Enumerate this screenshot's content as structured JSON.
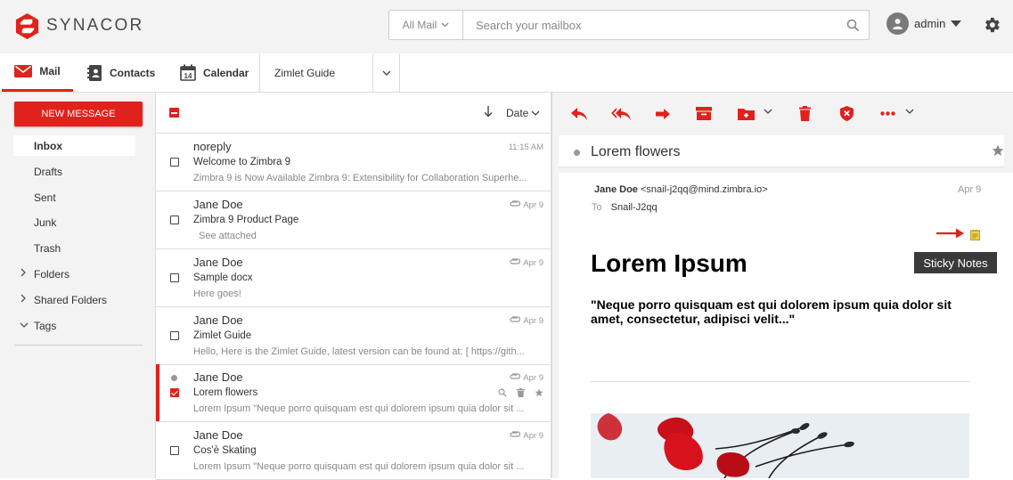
{
  "header": {
    "brand": "SYNACOR",
    "search_scope": "All Mail",
    "search_placeholder": "Search your mailbox",
    "username": "admin"
  },
  "nav": {
    "tabs": [
      {
        "label": "Mail",
        "icon": "mail-icon",
        "active": true
      },
      {
        "label": "Contacts",
        "icon": "contacts-icon"
      },
      {
        "label": "Calendar",
        "icon": "calendar-icon",
        "day": "14"
      }
    ],
    "zimlet_tab": "Zimlet Guide"
  },
  "sidebar": {
    "new_message": "NEW MESSAGE",
    "folders": [
      "Inbox",
      "Drafts",
      "Sent",
      "Junk",
      "Trash"
    ],
    "groups": [
      "Folders",
      "Shared Folders",
      "Tags"
    ],
    "active_folder": "Inbox"
  },
  "list": {
    "sort_label": "Date",
    "messages": [
      {
        "from": "noreply",
        "subject": "Welcome to Zimbra 9",
        "preview": "Zimbra 9 is Now Available Zimbra 9: Extensibility for Collaboration Superhe...",
        "time": "11:15 AM",
        "attachment": false
      },
      {
        "from": "Jane Doe",
        "subject": "Zimbra 9 Product Page",
        "preview": "See attached",
        "time": "Apr 9",
        "attachment": true
      },
      {
        "from": "Jane Doe",
        "subject": "Sample docx",
        "preview": "Here goes!",
        "time": "Apr 9",
        "attachment": true
      },
      {
        "from": "Jane Doe",
        "subject": "Zimlet Guide",
        "preview": "Hello, Here is the Zimlet Guide, latest version can be found at: [ https://gith...",
        "time": "Apr 9",
        "attachment": true
      },
      {
        "from": "Jane Doe",
        "subject": "Lorem flowers",
        "preview": "Lorem Ipsum \"Neque porro quisquam est qui dolorem ipsum quia dolor sit ...",
        "time": "Apr 9",
        "attachment": true,
        "selected": true,
        "unread": true
      },
      {
        "from": "Jane Doe",
        "subject": "Cos'è Skating",
        "preview": "Lorem Ipsum \"Neque porro quisquam est qui dolorem ipsum quia dolor sit ...",
        "time": "Apr 9",
        "attachment": true
      }
    ]
  },
  "reader": {
    "conversation_title": "Lorem flowers",
    "sender_name": "Jane Doe",
    "sender_email": "<snail-j2qq@mind.zimbra.io>",
    "date": "Apr 9",
    "to_label": "To",
    "to_value": "Snail-J2qq",
    "tooltip": "Sticky Notes",
    "heading": "Lorem Ipsum",
    "quote": "\"Neque porro quisquam est qui dolorem ipsum quia dolor sit amet, consectetur, adipisci velit...\""
  },
  "colors": {
    "accent": "#e1211b",
    "toolbar_icon": "#e1211b",
    "panel_bg": "#f3f3f3"
  }
}
